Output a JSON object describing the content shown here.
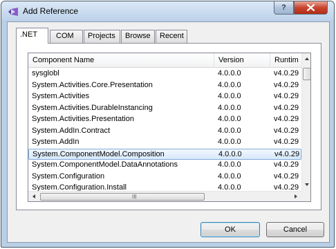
{
  "window": {
    "title": "Add Reference"
  },
  "titlebar_buttons": {
    "help": "?",
    "close": "X"
  },
  "tabs": [
    {
      "label": ".NET",
      "active": true
    },
    {
      "label": "COM",
      "active": false
    },
    {
      "label": "Projects",
      "active": false
    },
    {
      "label": "Browse",
      "active": false
    },
    {
      "label": "Recent",
      "active": false
    }
  ],
  "list": {
    "columns": {
      "name": "Component Name",
      "version": "Version",
      "runtime": "Runtim"
    },
    "rows": [
      {
        "name": "sysglobl",
        "version": "4.0.0.0",
        "runtime": "v4.0.29",
        "selected": false
      },
      {
        "name": "System.Activities.Core.Presentation",
        "version": "4.0.0.0",
        "runtime": "v4.0.29",
        "selected": false
      },
      {
        "name": "System.Activities",
        "version": "4.0.0.0",
        "runtime": "v4.0.29",
        "selected": false
      },
      {
        "name": "System.Activities.DurableInstancing",
        "version": "4.0.0.0",
        "runtime": "v4.0.29",
        "selected": false
      },
      {
        "name": "System.Activities.Presentation",
        "version": "4.0.0.0",
        "runtime": "v4.0.29",
        "selected": false
      },
      {
        "name": "System.AddIn.Contract",
        "version": "4.0.0.0",
        "runtime": "v4.0.29",
        "selected": false
      },
      {
        "name": "System.AddIn",
        "version": "4.0.0.0",
        "runtime": "v4.0.29",
        "selected": false
      },
      {
        "name": "System.ComponentModel.Composition",
        "version": "4.0.0.0",
        "runtime": "v4.0.29",
        "selected": true
      },
      {
        "name": "System.ComponentModel.DataAnnotations",
        "version": "4.0.0.0",
        "runtime": "v4.0.29",
        "selected": false
      },
      {
        "name": "System.Configuration",
        "version": "4.0.0.0",
        "runtime": "v4.0.29",
        "selected": false
      },
      {
        "name": "System.Configuration.Install",
        "version": "4.0.0.0",
        "runtime": "v4.0.29",
        "selected": false
      }
    ]
  },
  "scrollbar_grip": "III",
  "buttons": {
    "ok": "OK",
    "cancel": "Cancel"
  }
}
